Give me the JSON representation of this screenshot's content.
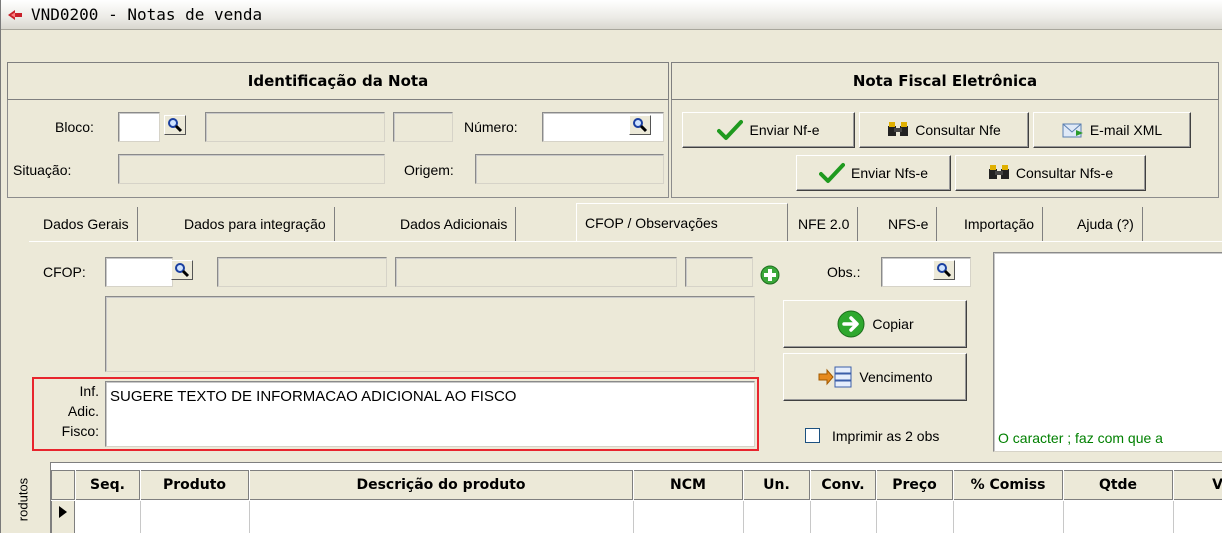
{
  "window": {
    "title": "VND0200 - Notas de venda"
  },
  "identificacao": {
    "header": "Identificação da Nota",
    "bloco_label": "Bloco:",
    "bloco_value": "",
    "numero_label": "Número:",
    "numero_value": "",
    "situacao_label": "Situação:",
    "situacao_value": "",
    "origem_label": "Origem:",
    "origem_value": ""
  },
  "nfe": {
    "header": "Nota Fiscal Eletrônica",
    "enviar_nfe": "Enviar Nf-e",
    "consultar_nfe": "Consultar Nfe",
    "email_xml": "E-mail XML",
    "enviar_nfse": "Enviar Nfs-e",
    "consultar_nfse": "Consultar Nfs-e"
  },
  "tabs": [
    {
      "label": "Dados Gerais"
    },
    {
      "label": "Dados para integração"
    },
    {
      "label": "Dados Adicionais"
    },
    {
      "label": "CFOP / Observações"
    },
    {
      "label": "NFE 2.0"
    },
    {
      "label": "NFS-e"
    },
    {
      "label": "Importação"
    },
    {
      "label": "Ajuda (?)"
    }
  ],
  "cfop": {
    "label": "CFOP:",
    "value": "",
    "obs_label": "Obs.:",
    "obs_value": "",
    "copiar": "Copiar",
    "vencimento": "Vencimento",
    "inf_label_1": "Inf.",
    "inf_label_2": "Adic.",
    "inf_label_3": "Fisco:",
    "inf_value": "SUGERE TEXTO DE INFORMACAO ADICIONAL AO FISCO",
    "imprimir_label": "Imprimir as 2 obs",
    "hint": "O caracter ; faz com que a"
  },
  "grid": {
    "side_label": "rodutos",
    "columns": [
      "Seq.",
      "Produto",
      "Descrição do produto",
      "NCM",
      "Un.",
      "Conv.",
      "Preço",
      "% Comiss",
      "Qtde",
      "V"
    ]
  },
  "colors": {
    "highlight": "#e8252d",
    "hint": "#008000"
  }
}
